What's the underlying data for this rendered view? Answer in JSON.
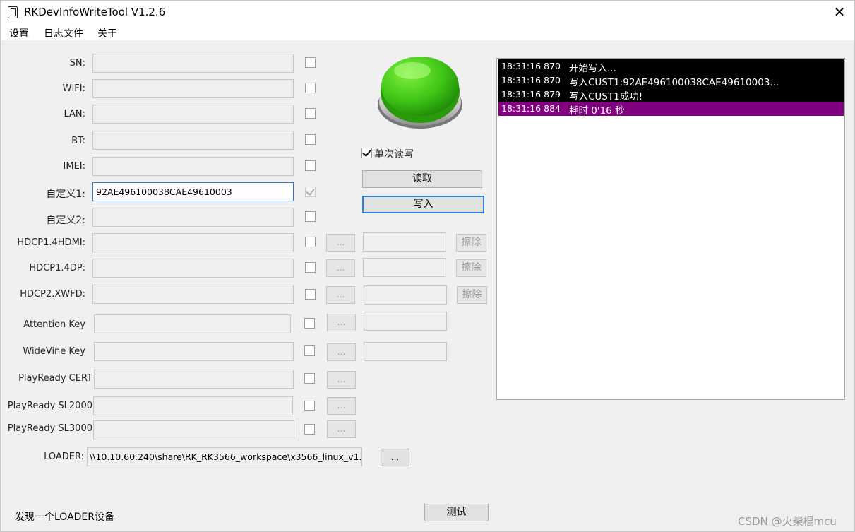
{
  "window": {
    "title": "RKDevInfoWriteTool V1.2.6",
    "close": "✕"
  },
  "menu": [
    "设置",
    "日志文件",
    "关于"
  ],
  "fields": [
    {
      "label": "SN:",
      "value": "",
      "active": false,
      "checked": false
    },
    {
      "label": "WIFI:",
      "value": "",
      "active": false,
      "checked": false
    },
    {
      "label": "LAN:",
      "value": "",
      "active": false,
      "checked": false
    },
    {
      "label": "BT:",
      "value": "",
      "active": false,
      "checked": false
    },
    {
      "label": "IMEI:",
      "value": "",
      "active": false,
      "checked": false
    },
    {
      "label": "自定义1:",
      "value": "92AE496100038CAE49610003",
      "active": true,
      "checked": true
    },
    {
      "label": "自定义2:",
      "value": "",
      "active": false,
      "checked": false
    }
  ],
  "key_fields": [
    {
      "label": "HDCP1.4HDMI:",
      "browse": "...",
      "erase": "擦除"
    },
    {
      "label": "HDCP1.4DP:",
      "browse": "...",
      "erase": "擦除"
    },
    {
      "label": "HDCP2.XWFD:",
      "browse": "...",
      "erase": "擦除"
    },
    {
      "label": "Attention Key",
      "browse": "..."
    },
    {
      "label": "WideVine Key",
      "browse": "..."
    },
    {
      "label": "PlayReady CERT",
      "browse": "..."
    },
    {
      "label": "PlayReady SL2000",
      "browse": "..."
    },
    {
      "label": "PlayReady SL3000",
      "browse": "..."
    }
  ],
  "loader": {
    "label": "LOADER:",
    "path": "\\\\10.10.60.240\\share\\RK_RK3566_workspace\\x3566_linux_v1.",
    "browse": "..."
  },
  "single_rw": {
    "label": "单次读写",
    "checked": true
  },
  "read_button": "读取",
  "write_button": "写入",
  "test_button": "测试",
  "log": [
    {
      "time": "18:31:16 870",
      "msg": "开始写入...",
      "highlight": false
    },
    {
      "time": "18:31:16 870",
      "msg": "写入CUST1:92AE496100038CAE49610003...",
      "highlight": false
    },
    {
      "time": "18:31:16 879",
      "msg": "写入CUST1成功!",
      "highlight": false
    },
    {
      "time": "18:31:16 884",
      "msg": "耗时 0'16 秒",
      "highlight": true
    }
  ],
  "status": "发现一个LOADER设备",
  "watermark": "CSDN @火柴棍mcu",
  "icons": {
    "app": "device-icon",
    "action": "green-round-button"
  }
}
